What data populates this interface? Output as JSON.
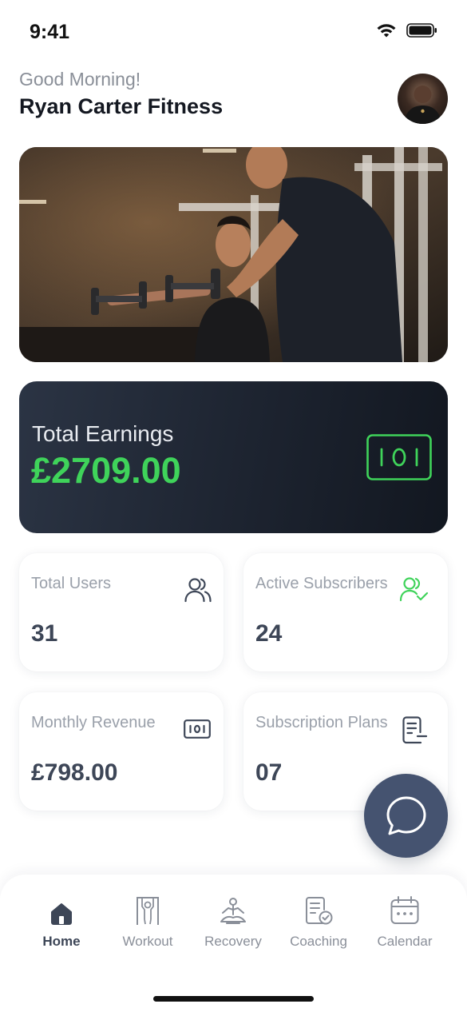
{
  "status_bar": {
    "time": "9:41"
  },
  "header": {
    "greeting": "Good Morning!",
    "name": "Ryan Carter Fitness"
  },
  "earnings": {
    "label": "Total Earnings",
    "value": "£2709.00",
    "icon": "cash-icon",
    "accent": "#3fd35a"
  },
  "stats": [
    {
      "label": "Total Users",
      "value": "31",
      "icon": "users-icon"
    },
    {
      "label": "Active Subscribers",
      "value": "24",
      "icon": "user-check-icon"
    },
    {
      "label": "Monthly Revenue",
      "value": "£798.00",
      "icon": "cash-icon"
    },
    {
      "label": "Subscription Plans",
      "value": "07",
      "icon": "document-icon"
    }
  ],
  "fab": {
    "icon": "chat-bubble-icon"
  },
  "tabs": [
    {
      "label": "Home",
      "icon": "home-icon",
      "active": true
    },
    {
      "label": "Workout",
      "icon": "pull-up-bar-icon",
      "active": false
    },
    {
      "label": "Recovery",
      "icon": "meditation-icon",
      "active": false
    },
    {
      "label": "Coaching",
      "icon": "clipboard-check-icon",
      "active": false
    },
    {
      "label": "Calendar",
      "icon": "calendar-icon",
      "active": false
    }
  ]
}
